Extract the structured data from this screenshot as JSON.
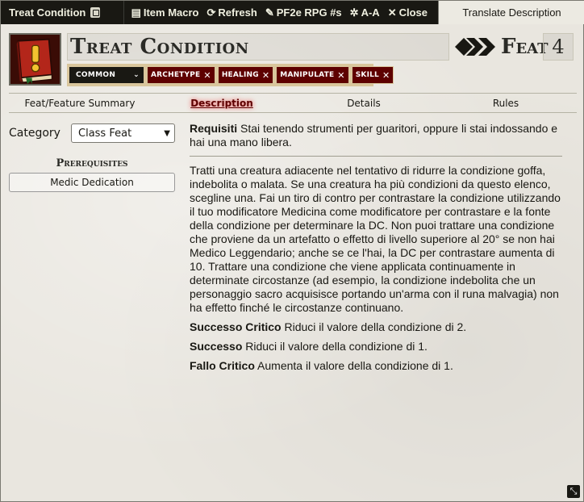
{
  "window": {
    "title": "Treat Condition",
    "header_buttons": [
      {
        "icon": "item-macro-icon",
        "label": "Item Macro"
      },
      {
        "icon": "refresh-icon",
        "label": "Refresh"
      },
      {
        "icon": "pf2e-rpg-icon",
        "label": "PF2e RPG #s"
      },
      {
        "icon": "font-size-icon",
        "label": "A-A"
      },
      {
        "icon": "close-icon",
        "label": "Close"
      }
    ],
    "translate_label": "Translate Description"
  },
  "item": {
    "name": "Treat Condition",
    "type_label": "Feat",
    "level": "4",
    "rarity": "COMMON",
    "traits": [
      "ARCHETYPE",
      "HEALING",
      "MANIPULATE",
      "SKILL"
    ]
  },
  "tabs": [
    "Feat/Feature Summary",
    "Description",
    "Details",
    "Rules"
  ],
  "active_tab": "Description",
  "sidebar": {
    "category_label": "Category",
    "category_value": "Class Feat",
    "prerequisites_title": "Prerequisites",
    "prerequisites": [
      "Medic Dedication"
    ]
  },
  "description": {
    "requirements_label": "Requisiti",
    "requirements_text": "Stai tenendo strumenti per guaritori, oppure li stai indossando e hai una mano libera.",
    "body": "Tratti una creatura adiacente nel tentativo di ridurre la condizione goffa, indebolita o malata. Se una creatura ha più condizioni da questo elenco, scegline una. Fai un tiro di contro per contrastare la condizione utilizzando il tuo modificatore Medicina come modificatore per contrastare e la fonte della condizione per determinare la DC. Non puoi trattare una condizione che proviene da un artefatto o effetto di livello superiore al 20° se non hai Medico Leggendario; anche se ce l'hai, la DC per contrastare aumenta di 10. Trattare una condizione che viene applicata continuamente in determinate circostanze (ad esempio, la condizione indebolita che un personaggio sacro acquisisce portando un'arma con il runa malvagia) non ha effetto finché le circostanze continuano.",
    "crit_success_label": "Successo Critico",
    "crit_success_text": "Riduci il valore della condizione di 2.",
    "success_label": "Successo",
    "success_text": "Riduci il valore della condizione di 1.",
    "crit_failure_label": "Fallo Critico",
    "crit_failure_text": "Aumenta il valore della condizione di 1."
  },
  "colors": {
    "trait_bg": "#5e0000",
    "rarity_bg": "#191813",
    "header_bg": "#191813",
    "active_tab": "#5e0000"
  }
}
